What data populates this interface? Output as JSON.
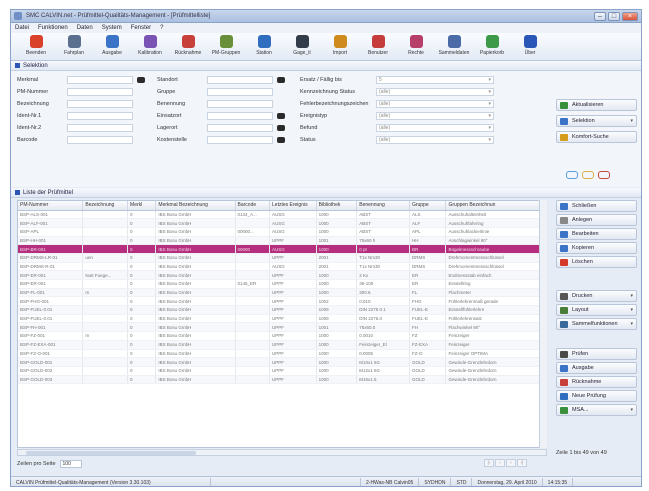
{
  "window": {
    "title": "SMC CALVIN.net - Prüfmittel-Qualitäts-Management - [Prüfmittelliste]"
  },
  "menu": [
    "Datei",
    "Funktionen",
    "Daten",
    "System",
    "Fenster",
    "?"
  ],
  "toolbar": [
    {
      "label": "Beenden",
      "icon": "exit-icon",
      "color": "#d9412b"
    },
    {
      "label": "Fahrplan",
      "icon": "plan-icon",
      "color": "#5b6f8f"
    },
    {
      "label": "Ausgabe",
      "icon": "output-icon",
      "color": "#3b74c7"
    },
    {
      "label": "Kalibration",
      "icon": "calibration-icon",
      "color": "#7a54b5"
    },
    {
      "label": "Rücknahme",
      "icon": "return-icon",
      "color": "#c8403a"
    },
    {
      "label": "PM-Gruppen",
      "icon": "groups-icon",
      "color": "#6a8f3a"
    },
    {
      "label": "Station",
      "icon": "station-icon",
      "color": "#2f6dbf"
    },
    {
      "label": "Gage_it",
      "icon": "gage-icon",
      "color": "#333c4a"
    },
    {
      "label": "Import",
      "icon": "import-icon",
      "color": "#d08b1e"
    },
    {
      "label": "Benutzer",
      "icon": "user-icon",
      "color": "#c63b3b"
    },
    {
      "label": "Rechte",
      "icon": "rights-icon",
      "color": "#b83e6a"
    },
    {
      "label": "Sammeldaten",
      "icon": "collect-icon",
      "color": "#4a6aa8"
    },
    {
      "label": "Papierkorb",
      "icon": "trash-icon",
      "color": "#3c9a48"
    },
    {
      "label": "Über",
      "icon": "info-icon",
      "color": "#2a56b8"
    }
  ],
  "filter": {
    "title": "Selektion",
    "left": [
      "Merkmal",
      "PM-Nummer",
      "Bezeichnung",
      "Ident-Nr.1",
      "Ident-Nr.2",
      "Barcode"
    ],
    "middle": [
      "Standort",
      "Gruppe",
      "Benennung",
      "Einsatzort",
      "Lagerort",
      "Kostenstelle"
    ],
    "right": [
      "Ersatz / Fällig bis",
      "Kennzeichnung Status",
      "Fehlerbezeichnungszeichen",
      "Ereignistyp",
      "Befund",
      "Status"
    ],
    "right_values": [
      "5",
      "(alle)",
      "(alle)",
      "(alle)",
      "(alle)",
      "(alle)"
    ],
    "buttons": [
      "Aktualisieren",
      "Selektion",
      "Komfort-Suche"
    ]
  },
  "list": {
    "title": "Liste der Prüfmittel",
    "columns": [
      "PM-Nummer",
      "Bezeichnung",
      "Merkl",
      "Merkmal Bezeichnung",
      "Barcode",
      "Letztes Ereignis",
      "Bibliothek",
      "Benennung",
      "Gruppe",
      "Gruppen Bezeichnun"
    ],
    "rows": [
      [
        "BSP-ALS-001",
        "",
        "0",
        "IBS Bosu GmbH",
        "0134_A...",
        "AUSG",
        "1000",
        "ABST",
        "ALS",
        "Ausschuhalteinheit"
      ],
      [
        "BSP-ALF-001",
        "",
        "0",
        "IBS Bosu GmbH",
        "",
        "AUSG",
        "1000",
        "ABST",
        "ALF",
        "Ausschuhfahrring"
      ],
      [
        "BSP-APL",
        "",
        "0",
        "IBS Bosu GmbH",
        "00000...",
        "AUSG",
        "1000",
        "ABST",
        "APL",
        "Ausschuhlackierlinie"
      ],
      [
        "BSP-HH-001",
        "",
        "0",
        "IBS Bosu GmbH",
        "",
        "UPPF",
        "1001",
        "75x60 h",
        "HH",
        "Anschlagwinkel 90°"
      ],
      [
        "BSP-BR-001",
        "",
        "0",
        "IBS Bosu GmbH",
        "00000",
        "AUSG",
        "1000",
        "0 pt",
        "BR",
        "Bügelmessschraube"
      ],
      [
        "BSP-DRMS-LR-01",
        "uen",
        "0",
        "IBS Bosu GmbH",
        "",
        "UPPF",
        "2001",
        "T1x Nm30",
        "DRMS",
        "Drehmomentmessschlüssel"
      ],
      [
        "BSP-DRMS-R-01",
        "",
        "0",
        "IBS Bosu GmbH",
        "",
        "AUSG",
        "2001",
        "T1x Nm30",
        "DRMS",
        "Drehmomentmessschlüssel"
      ],
      [
        "BSP-ER-001",
        "Nutt Fuege...",
        "0",
        "IBS Bosu GmbH",
        "",
        "UPPF",
        "1000",
        "2 Kx",
        "ER",
        "Endmessstab einfach"
      ],
      [
        "BSP-ER-001",
        "",
        "0",
        "IBS Bosu GmbH",
        "0145_ER",
        "UPPF",
        "1000",
        "36-100",
        "ER",
        "Einstellring"
      ],
      [
        "BSP-FL-001",
        "m",
        "0",
        "IBS Bosu GmbH",
        "",
        "UPPF",
        "1000",
        "300.6",
        "FL",
        "Flachmeter"
      ],
      [
        "BSP-FHG-001",
        "",
        "0",
        "IBS Bosu GmbH",
        "",
        "UPPF",
        "1002",
        "0.010",
        "FHG",
        "Fühlerlehrenmaß gerade"
      ],
      [
        "BSP-FUEL-0.01",
        "",
        "0",
        "IBS Bosu GmbH",
        "",
        "UPPF",
        "1009",
        "DIN 2276 0.1",
        "FUEL-E",
        "Einstellfühlerlehre"
      ],
      [
        "BSP-FUEL-0.01",
        "",
        "0",
        "IBS Bosu GmbH",
        "",
        "UPPF",
        "1009",
        "DIN 2276.0",
        "FUEL-E",
        "Fühlerlehrensatz"
      ],
      [
        "BSP-FH-001",
        "",
        "0",
        "IBS Bosu GmbH",
        "",
        "UPPF",
        "1001",
        "75x60.0",
        "FH",
        "Flachwinkel 90°"
      ],
      [
        "BSP-FZ-001",
        "m",
        "0",
        "IBS Bosu GmbH",
        "",
        "UPPF",
        "1000",
        "0.0010",
        "FZ",
        "Feinzeiger"
      ],
      [
        "BSP-FZ-EXA-001",
        "",
        "0",
        "IBS Bosu GmbH",
        "",
        "UPPF",
        "1000",
        "Feinzeiger_El",
        "FZ-EXA",
        "Feinzeiger"
      ],
      [
        "BSP-FZ-O-001",
        "",
        "0",
        "IBS Bosu GmbH",
        "",
        "UPPF",
        "1000",
        "0.0005",
        "FZ-O",
        "Feinzeiger OPTIMA"
      ],
      [
        "BSP-GOLD-001",
        "",
        "0",
        "IBS Bosu GmbH",
        "",
        "UPPF",
        "1000",
        "M10x1 6G",
        "GOLD",
        "Gewinde-Grenzlehrdorn"
      ],
      [
        "BSP-GOLD-002",
        "",
        "0",
        "IBS Bosu GmbH",
        "",
        "UPPF",
        "1000",
        "M12x1 6G",
        "GOLD",
        "Gewinde-Grenzlehrdorn"
      ],
      [
        "BSP-GOLD-003",
        "",
        "0",
        "IBS Bosu GmbH",
        "",
        "UPPF",
        "1000",
        "M16x1.5",
        "GOLD",
        "Gewinde-Grenzlehrdorn"
      ]
    ],
    "selected_row": 4,
    "rows_per_page_label": "Zeilen pro Seite",
    "rows_per_page": "100",
    "row_info": "Zeile 1 bis 49 von 49",
    "actions": [
      "Schließen",
      "Anlegen",
      "Bearbeiten",
      "Kopieren",
      "Löschen",
      "Drucken",
      "Layout",
      "Sammelfunktionen",
      "Prüfen",
      "Ausgabe",
      "Rücknahme",
      "Neue Prüfung",
      "MSA..."
    ]
  },
  "status": {
    "version": "CALVIN Prüfmittel-Qualitäts-Management (Version 3.30.103)",
    "user": "2-HWas-NB Calvin05",
    "db": "SYDHDN",
    "mode": "STD",
    "date": "Donnerstag, 29. April 2010",
    "time": "14:15:35"
  }
}
